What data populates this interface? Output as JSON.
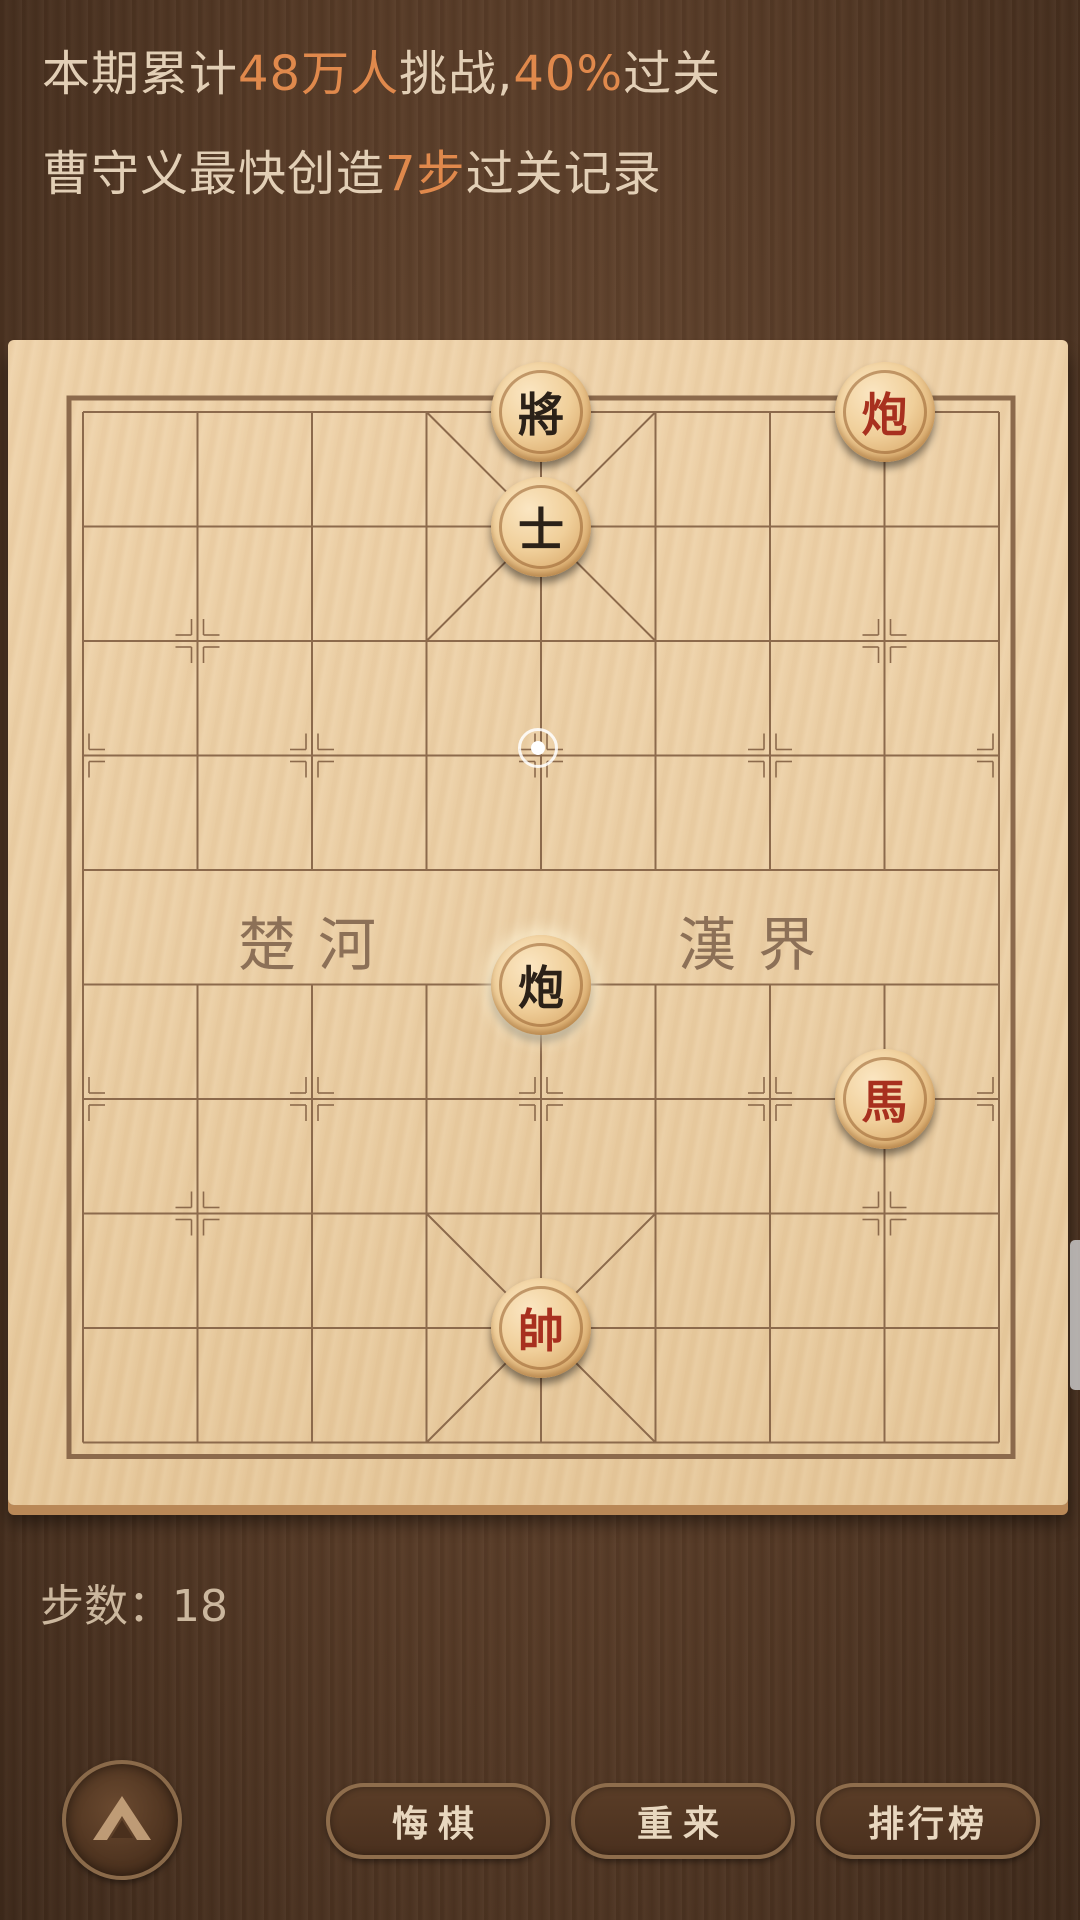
{
  "header": {
    "line1": {
      "prefix": "本期累计",
      "challengers": "48万人",
      "middle": "挑战,",
      "pass_rate": "40%",
      "suffix": "过关"
    },
    "line2": {
      "prefix": "曹守义最快创造",
      "record_steps": "7步",
      "suffix": "过关记录"
    }
  },
  "board": {
    "river_left": "楚河",
    "river_right": "漢界",
    "pieces": [
      {
        "char": "將",
        "side": "black",
        "file": 4,
        "rank": 0
      },
      {
        "char": "士",
        "side": "black",
        "file": 4,
        "rank": 1
      },
      {
        "char": "炮",
        "side": "red",
        "file": 7,
        "rank": 0
      },
      {
        "char": "炮",
        "side": "black",
        "file": 4,
        "rank": 5,
        "selected": true
      },
      {
        "char": "馬",
        "side": "red",
        "file": 7,
        "rank": 6
      },
      {
        "char": "帥",
        "side": "red",
        "file": 4,
        "rank": 8
      }
    ]
  },
  "status": {
    "steps_label": "步数：18"
  },
  "buttons": {
    "undo": "悔棋",
    "restart": "重来",
    "leaderboard": "排行榜"
  },
  "colors": {
    "highlight": "#e0894c",
    "red_piece": "#a8301f",
    "black_piece": "#2b2118"
  }
}
